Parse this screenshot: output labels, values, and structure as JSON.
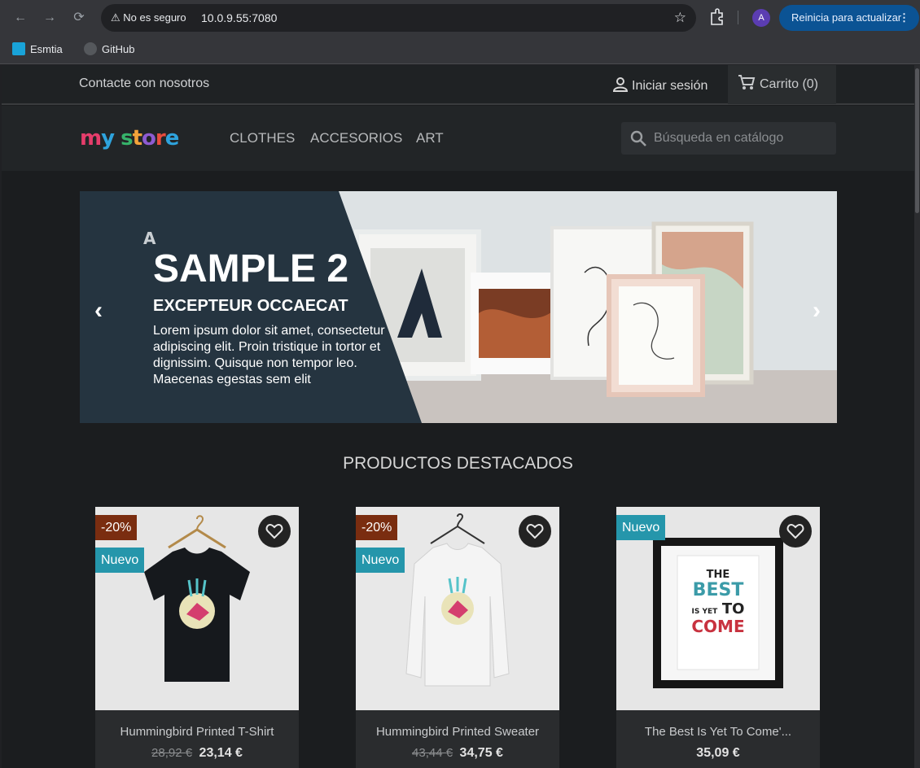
{
  "browser": {
    "security_label": "No es seguro",
    "url": "10.0.9.55:7080",
    "avatar_letter": "A",
    "update_label": "Reinicia para actualizar",
    "bookmarks": [
      {
        "label": "Esmtia",
        "icon": "esemtia-favicon"
      },
      {
        "label": "GitHub",
        "icon": "github-icon"
      }
    ]
  },
  "topnav": {
    "contact": "Contacte con nosotros",
    "login": "Iniciar sesión",
    "cart": "Carrito (0)"
  },
  "header": {
    "logo": "my store",
    "menu": [
      "Clothes",
      "Accesorios",
      "Art"
    ],
    "search_placeholder": "Búsqueda en catálogo"
  },
  "slider": {
    "title": "SAMPLE 2",
    "subtitle": "EXCEPTEUR OCCAECAT",
    "text": "Lorem ipsum dolor sit amet, consectetur adipiscing elit. Proin tristique in tortor et dignissim. Quisque non tempor leo. Maecenas egestas sem elit"
  },
  "featured": {
    "title": "Productos destacados",
    "products": [
      {
        "name": "Hummingbird Printed T-Shirt",
        "old_price": "28,92 €",
        "price": "23,14 €",
        "discount": "-20%",
        "flag": "Nuevo"
      },
      {
        "name": "Hummingbird Printed Sweater",
        "old_price": "43,44 €",
        "price": "34,75 €",
        "discount": "-20%",
        "flag": "Nuevo"
      },
      {
        "name": "The Best Is Yet To Come'...",
        "price": "35,09 €",
        "flag": "Nuevo",
        "poster_lines": [
          "THE",
          "BEST",
          "IS YET",
          "TO",
          "COME"
        ]
      }
    ]
  },
  "colors": {
    "discount_flag": "#7a2d10",
    "new_flag": "#2596ab",
    "update_button": "#0b5394"
  }
}
